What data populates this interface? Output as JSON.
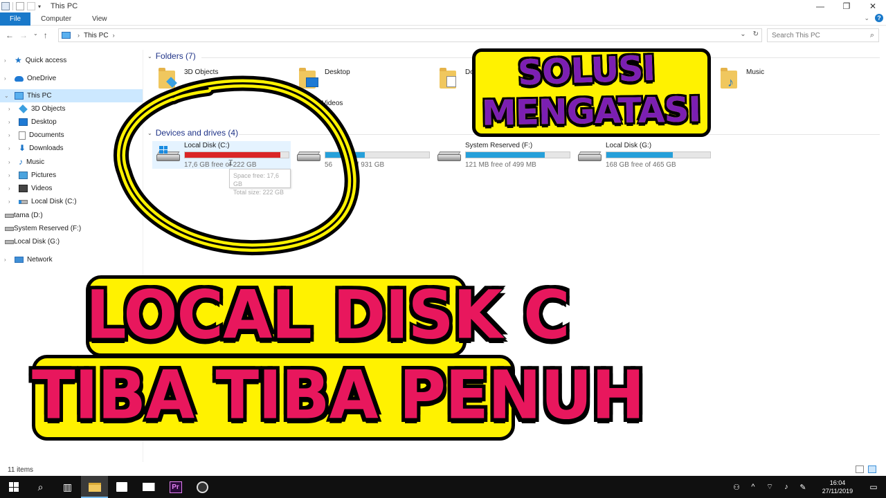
{
  "window": {
    "title": "This PC",
    "controls": {
      "minimize": "—",
      "maximize": "❐",
      "close": "✕"
    }
  },
  "ribbon": {
    "tabs": [
      {
        "label": "File",
        "active": true
      },
      {
        "label": "Computer"
      },
      {
        "label": "View"
      }
    ]
  },
  "address": {
    "path": "This PC",
    "search_placeholder": "Search This PC"
  },
  "sidebar": {
    "items": [
      {
        "label": "Quick access",
        "icon": "star-icon"
      },
      {
        "label": "OneDrive",
        "icon": "cloud-icon"
      },
      {
        "label": "This PC",
        "icon": "computer-icon",
        "selected": true
      },
      {
        "label": "3D Objects",
        "icon": "cube-icon"
      },
      {
        "label": "Desktop",
        "icon": "desktop-icon"
      },
      {
        "label": "Documents",
        "icon": "document-icon"
      },
      {
        "label": "Downloads",
        "icon": "download-icon"
      },
      {
        "label": "Music",
        "icon": "music-icon"
      },
      {
        "label": "Pictures",
        "icon": "picture-icon"
      },
      {
        "label": "Videos",
        "icon": "video-icon"
      },
      {
        "label": "Local Disk (C:)",
        "icon": "windows-drive-icon"
      },
      {
        "label": "tama (D:)",
        "icon": "drive-icon"
      },
      {
        "label": "System Reserved (F:)",
        "icon": "drive-icon"
      },
      {
        "label": "Local Disk (G:)",
        "icon": "drive-icon"
      },
      {
        "label": "Network",
        "icon": "network-icon"
      }
    ]
  },
  "folders": {
    "header": "Folders (7)",
    "items": [
      {
        "label": "3D Objects"
      },
      {
        "label": "Desktop"
      },
      {
        "label": "Documents"
      },
      {
        "label": "Music"
      },
      {
        "label": "Videos"
      }
    ]
  },
  "drives": {
    "header": "Devices and drives (4)",
    "items": [
      {
        "name": "Local Disk (C:)",
        "info": "17,6 GB free of 222 GB",
        "used_fraction": 0.92,
        "full": true
      },
      {
        "name": "",
        "info": "56",
        "info_tail": "of 931 GB",
        "used_fraction": 0.38,
        "full": false
      },
      {
        "name": "System Reserved (F:)",
        "info": "121 MB free of 499 MB",
        "used_fraction": 0.76,
        "full": false
      },
      {
        "name": "Local Disk (G:)",
        "info": "168 GB free of 465 GB",
        "used_fraction": 0.64,
        "full": false
      }
    ]
  },
  "tooltip": {
    "line1": "Space free: 17,6 GB",
    "line2": "Total size: 222 GB"
  },
  "overlay": {
    "top_line1": "SOLUSI",
    "top_line2": "MENGATASI",
    "bottom_line1": "LOCAL DISK C",
    "bottom_line2": "TIBA TIBA PENUH",
    "colors": {
      "purple": "#7b1fb2",
      "pink": "#e8175d",
      "yellow": "#fff200"
    }
  },
  "status": {
    "items_count": "11 items"
  },
  "taskbar": {
    "time": "16:04",
    "date": "27/11/2019",
    "premiere_label": "Pr"
  }
}
